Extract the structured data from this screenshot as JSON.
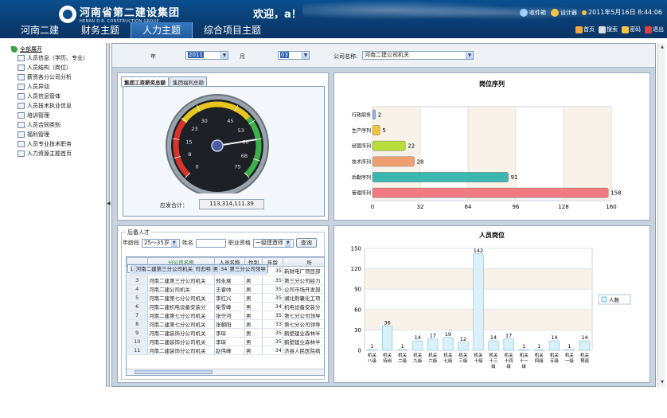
{
  "header": {
    "logo_cn": "河南省第二建设集团",
    "logo_en": "HENAN D.R. CONSTRUCTION GROUP",
    "welcome": "欢迎，a！",
    "links": [
      "收件箱",
      "设计器"
    ],
    "datetime": "2011年5月16日 8:44:06"
  },
  "nav": {
    "tabs": [
      "河南二建",
      "财务主题",
      "人力主题",
      "综合项目主题"
    ],
    "active_tab": 2,
    "quick_links": [
      "首页",
      "搜索",
      "密码",
      "退出"
    ]
  },
  "sidebar": {
    "root": "全部展开",
    "items": [
      "人员信息（学历、专业）",
      "人员结构（岗位）",
      "薪资各分公司分析",
      "人员异动",
      "人员信息管体",
      "人员技术执业信息",
      "培训管理",
      "人员合同类别",
      "福利管理",
      "人员专业技术职务",
      "人力资源主题首页"
    ]
  },
  "filters": {
    "year_label": "年",
    "year_value": "2011",
    "month_label": "月",
    "month_value": "03",
    "company_label": "公司名称:",
    "company_value": "河南二建公司机关"
  },
  "gauge": {
    "tabs": [
      "集团工资薪资总额",
      "集团福利总额"
    ],
    "scale": [
      0,
      8,
      15,
      23,
      30,
      45,
      53,
      60,
      68,
      75
    ],
    "needle_value": 60,
    "total_label": "应发合计：",
    "total_value": "113,314,111.39"
  },
  "talent": {
    "title": "后备人才",
    "age_label": "年龄段",
    "age_value": "25～35岁",
    "name_label": "姓名",
    "qual_label": "职业资格",
    "qual_value": "一级建造师",
    "query_button": "查询",
    "columns": [
      "",
      "分公司名称",
      "人员名称",
      "性别",
      "年龄",
      "所"
    ],
    "rows": [
      [
        "1",
        "河南二建第三分公司机关",
        "司忠明",
        "男",
        "34",
        "第三分公司领导"
      ],
      [
        "2",
        "河南二建第三分公司机关",
        "李庆",
        "男",
        "35",
        "新财电厂项目部"
      ],
      [
        "3",
        "河南二建第三分公司机关",
        "郑永展",
        "男",
        "35",
        "第三分公司经力"
      ],
      [
        "4",
        "河南二建公司机关",
        "王睿帅",
        "男",
        "35",
        "公司市场开发部"
      ],
      [
        "5",
        "河南二建第七分公司机关",
        "李红兴",
        "男",
        "35",
        "湖北荆襄化工项"
      ],
      [
        "6",
        "河南二建机电设备安装分",
        "柴雪峰",
        "男",
        "34",
        "机电设备安装分"
      ],
      [
        "7",
        "河南二建第七分公司机关",
        "张守河",
        "男",
        "35",
        "第七分公司领导"
      ],
      [
        "8",
        "河南二建第七分公司机关",
        "张朝阳",
        "男",
        "33",
        "第七分公司领导"
      ],
      [
        "9",
        "河南二建装饰分公司机关",
        "李琛",
        "男",
        "35",
        "鹤壁建业森林半"
      ],
      [
        "10",
        "河南二建装饰分公司机关",
        "李琛",
        "男",
        "35",
        "鹤壁建业森林半"
      ],
      [
        "11",
        "河南二建装饰分公司机关",
        "赵伟峰",
        "男",
        "34",
        "济县人民医院病"
      ]
    ]
  },
  "chart_data": [
    {
      "type": "bar",
      "orientation": "horizontal",
      "title": "岗位序列",
      "categories": [
        "行政职务",
        "生产序列",
        "经营序列",
        "技术序列",
        "后勤序列",
        "管理序列"
      ],
      "values": [
        2,
        5,
        22,
        28,
        91,
        158
      ],
      "xlim": [
        0,
        160
      ],
      "xticks": [
        0,
        32,
        64,
        96,
        128,
        160
      ],
      "colors": [
        "#8fb0e8",
        "#f2c23a",
        "#b7dd3b",
        "#f0a070",
        "#3cb8b0",
        "#f07a80"
      ],
      "grid": true
    },
    {
      "type": "bar",
      "title": "人员岗位",
      "categories": [
        "机关八级",
        "机关待岗",
        "机关二级",
        "机关九级",
        "机关六级",
        "机关七级",
        "机关三级",
        "机关十级",
        "机关十三级",
        "机关十四级",
        "机关十一级",
        "机关四级",
        "机关五级",
        "机关一级",
        "机关预退"
      ],
      "series": [
        {
          "name": "人数",
          "values": [
            1,
            36,
            1,
            14,
            17,
            19,
            12,
            142,
            14,
            17,
            1,
            1,
            14,
            1,
            14
          ]
        }
      ],
      "ylim": [
        0,
        150
      ],
      "yticks": [
        0,
        30,
        60,
        90,
        120,
        150
      ],
      "legend": "right",
      "grid": true
    }
  ]
}
